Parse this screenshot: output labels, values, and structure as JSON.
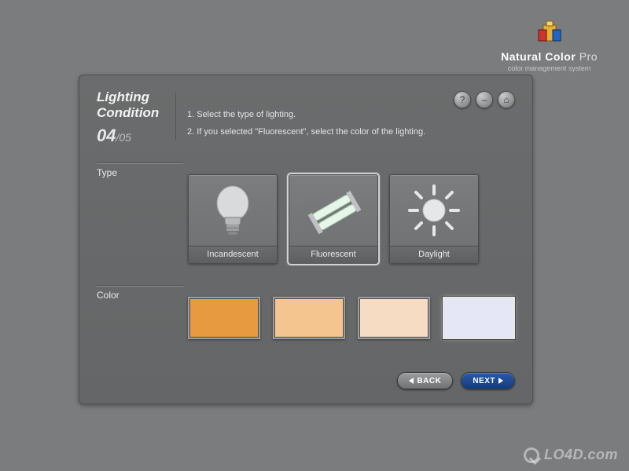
{
  "brand": {
    "name_main": "Natural Color",
    "name_sub": "Pro",
    "tagline": "color management system"
  },
  "header": {
    "title": "Lighting Condition",
    "step_current": "04",
    "step_total": "/05",
    "instructions": [
      "1.  Select the type of lighting.",
      "2.  If you selected \"Fluorescent\", select the color of the lighting."
    ]
  },
  "topbuttons": {
    "help": "?",
    "minimize": "–",
    "home": "⌂"
  },
  "sections": {
    "type_label": "Type",
    "color_label": "Color"
  },
  "types": [
    {
      "id": "incandescent",
      "label": "Incandescent",
      "selected": false
    },
    {
      "id": "fluorescent",
      "label": "Fluorescent",
      "selected": true
    },
    {
      "id": "daylight",
      "label": "Daylight",
      "selected": false
    }
  ],
  "colors": [
    {
      "id": "warm-orange",
      "hex": "#e79a3f",
      "selected": false
    },
    {
      "id": "light-orange",
      "hex": "#f4c58e",
      "selected": false
    },
    {
      "id": "pale-peach",
      "hex": "#f5dcc2",
      "selected": false
    },
    {
      "id": "cool-white",
      "hex": "#e5e6f6",
      "selected": true
    }
  ],
  "nav": {
    "back": "BACK",
    "next": "NEXT"
  },
  "watermark": "LO4D.com"
}
